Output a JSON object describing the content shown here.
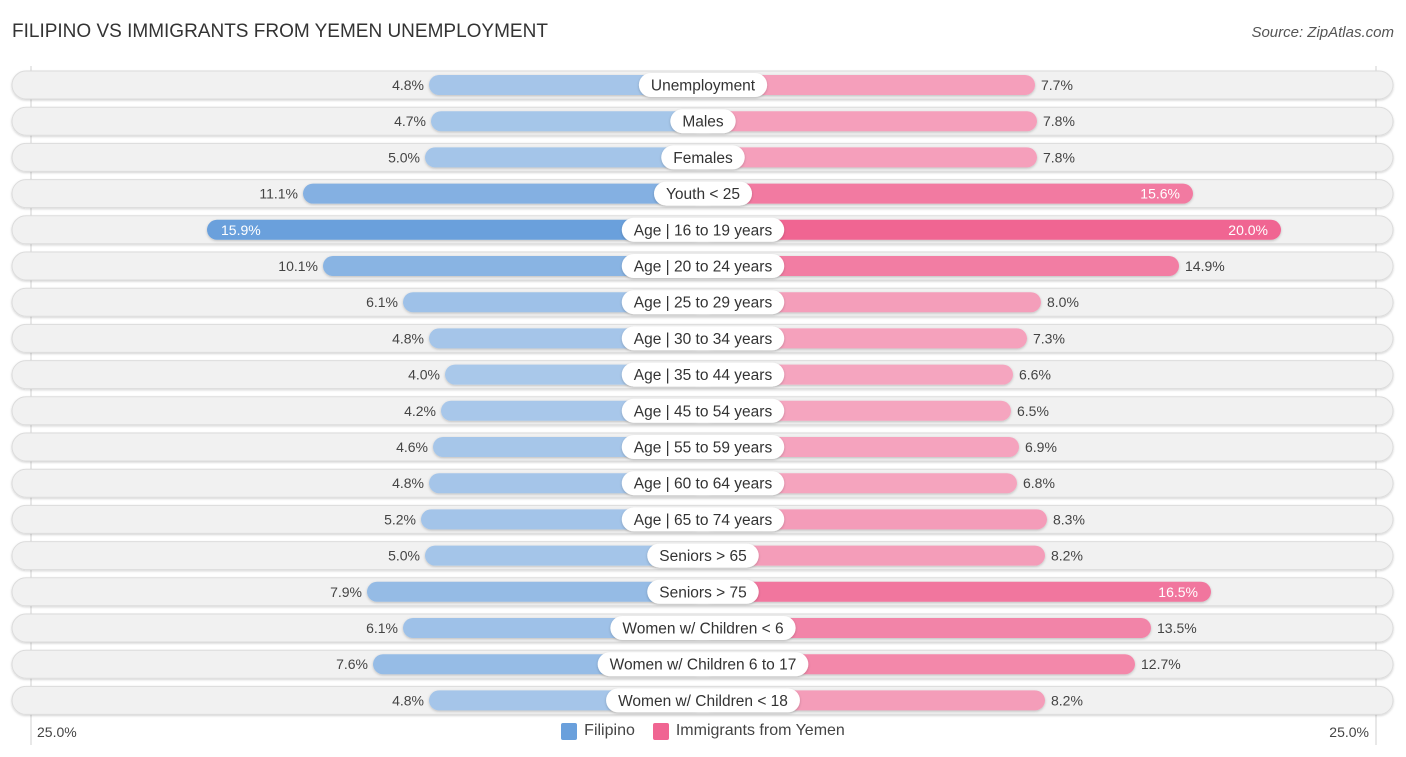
{
  "header": {
    "title": "FILIPINO VS IMMIGRANTS FROM YEMEN UNEMPLOYMENT",
    "source": "Source: ZipAtlas.com"
  },
  "colors": {
    "filipino": "#6aa0dc",
    "filipino_light": "#a9c8ea",
    "yemen": "#f06592",
    "yemen_light": "#f5a5bf",
    "row_bg": "#f1f1f1",
    "row_border": "#dcdcdc"
  },
  "legend": {
    "left_axis": "25.0%",
    "right_axis": "25.0%",
    "items": [
      {
        "label": "Filipino",
        "color": "#6aa0dc"
      },
      {
        "label": "Immigrants from Yemen",
        "color": "#f06592"
      }
    ]
  },
  "chart_data": {
    "type": "bar",
    "orientation": "horizontal-diverging",
    "title": "FILIPINO VS IMMIGRANTS FROM YEMEN UNEMPLOYMENT",
    "xlabel": "",
    "ylabel": "",
    "xlim": [
      0,
      25
    ],
    "axis_tick_labels": [
      "25.0%",
      "25.0%"
    ],
    "legend_position": "bottom-center",
    "categories": [
      "Unemployment",
      "Males",
      "Females",
      "Youth < 25",
      "Age | 16 to 19 years",
      "Age | 20 to 24 years",
      "Age | 25 to 29 years",
      "Age | 30 to 34 years",
      "Age | 35 to 44 years",
      "Age | 45 to 54 years",
      "Age | 55 to 59 years",
      "Age | 60 to 64 years",
      "Age | 65 to 74 years",
      "Seniors > 65",
      "Seniors > 75",
      "Women w/ Children < 6",
      "Women w/ Children 6 to 17",
      "Women w/ Children < 18"
    ],
    "series": [
      {
        "name": "Filipino",
        "side": "left",
        "values": [
          4.8,
          4.7,
          5.0,
          11.1,
          15.9,
          10.1,
          6.1,
          4.8,
          4.0,
          4.2,
          4.6,
          4.8,
          5.2,
          5.0,
          7.9,
          6.1,
          7.6,
          4.8
        ],
        "labels": [
          "4.8%",
          "4.7%",
          "5.0%",
          "11.1%",
          "15.9%",
          "10.1%",
          "6.1%",
          "4.8%",
          "4.0%",
          "4.2%",
          "4.6%",
          "4.8%",
          "5.2%",
          "5.0%",
          "7.9%",
          "6.1%",
          "7.6%",
          "4.8%"
        ]
      },
      {
        "name": "Immigrants from Yemen",
        "side": "right",
        "values": [
          7.7,
          7.8,
          7.8,
          15.6,
          20.0,
          14.9,
          8.0,
          7.3,
          6.6,
          6.5,
          6.9,
          6.8,
          8.3,
          8.2,
          16.5,
          13.5,
          12.7,
          8.2
        ],
        "labels": [
          "7.7%",
          "7.8%",
          "7.8%",
          "15.6%",
          "20.0%",
          "14.9%",
          "8.0%",
          "7.3%",
          "6.6%",
          "6.5%",
          "6.9%",
          "6.8%",
          "8.3%",
          "8.2%",
          "16.5%",
          "13.5%",
          "12.7%",
          "8.2%"
        ]
      }
    ]
  }
}
